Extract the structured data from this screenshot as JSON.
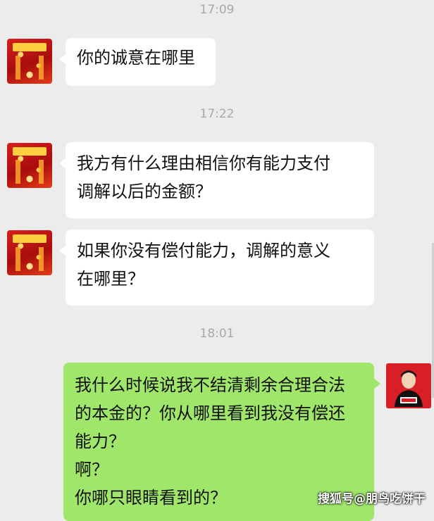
{
  "timestamps": [
    "17:09",
    "17:22",
    "18:01"
  ],
  "messages": [
    {
      "lines": [
        "你的诚意在哪里"
      ]
    },
    {
      "lines": [
        "我方有什么理由相信你有能力支付",
        "调解以后的金额？"
      ]
    },
    {
      "lines": [
        "如果你没有偿付能力，调解的意义",
        "在哪里？"
      ]
    },
    {
      "lines": [
        "我什么时候说我不结清剩余合理合法",
        "的本金的？你从哪里看到我没有偿还",
        "能力？",
        "啊？",
        "你哪只眼睛看到的？"
      ]
    }
  ],
  "watermark": "搜狐号@朋鸟吃饼干",
  "colors": {
    "background": "#ececec",
    "incoming": "#ffffff",
    "outgoing": "#9fe66b",
    "timestamp": "#a9a9a9"
  }
}
